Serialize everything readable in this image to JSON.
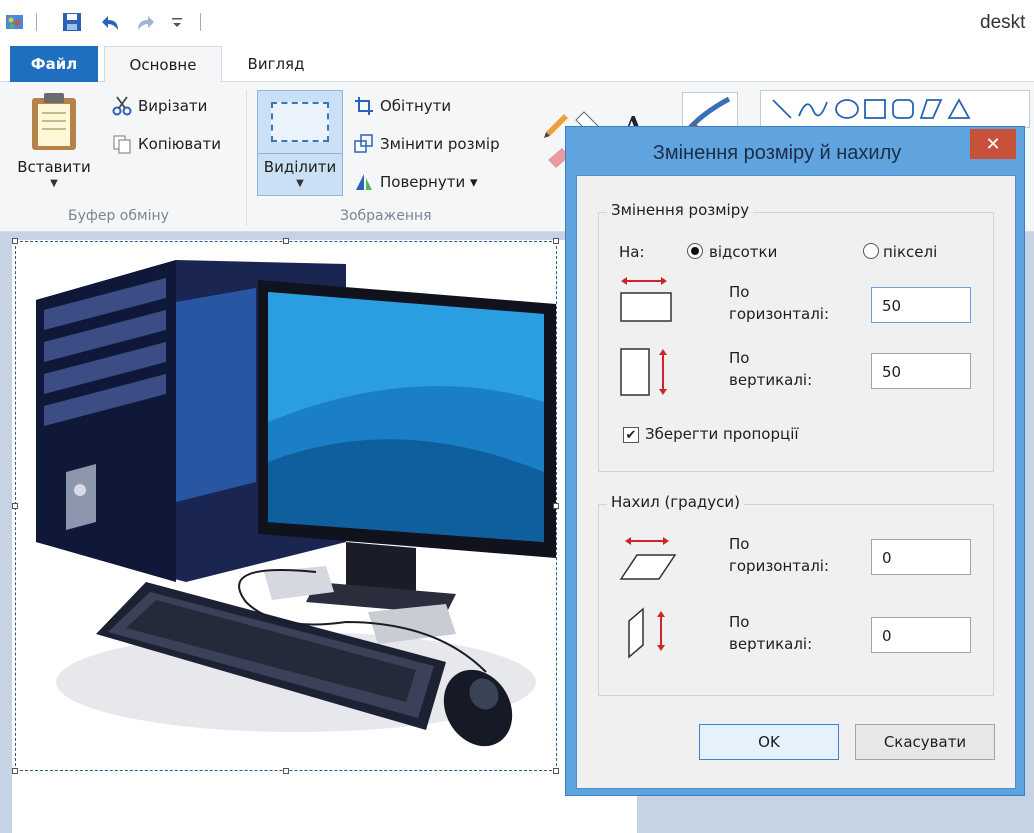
{
  "window": {
    "title": "deskt"
  },
  "ribbon": {
    "tabs": {
      "file": "Файл",
      "home": "Основне",
      "view": "Вигляд"
    },
    "clipboard": {
      "paste": "Вставити",
      "cut": "Вирізати",
      "copy": "Копіювати",
      "group_label": "Буфер обміну"
    },
    "image": {
      "select": "Виділити",
      "crop": "Обітнути",
      "resize": "Змінити розмір",
      "rotate": "Повернути ▾",
      "group_label": "Зображення"
    }
  },
  "dialog": {
    "title": "Змінення розміру й нахилу",
    "close": "✕",
    "resize_group": {
      "legend": "Змінення розміру",
      "by_label": "На:",
      "percent_label": "відсотки",
      "pixels_label": "пікселі",
      "horizontal_label_1": "По",
      "horizontal_label_2": "горизонталі:",
      "horizontal_value": "50",
      "vertical_label_1": "По",
      "vertical_label_2": "вертикалі:",
      "vertical_value": "50",
      "keep_aspect_label": "Зберегти пропорції",
      "keep_aspect_checked": true,
      "selected_unit": "percent"
    },
    "skew_group": {
      "legend": "Нахил (градуси)",
      "horizontal_label_1": "По",
      "horizontal_label_2": "горизонталі:",
      "horizontal_value": "0",
      "vertical_label_1": "По",
      "vertical_label_2": "вертикалі:",
      "vertical_value": "0"
    },
    "ok": "OK",
    "cancel": "Скасувати"
  },
  "colors": {
    "file_tab": "#1e6fc0",
    "dialog_frame": "#5fa3df",
    "close_button": "#c7513a",
    "selection": "#cbe0f5"
  }
}
